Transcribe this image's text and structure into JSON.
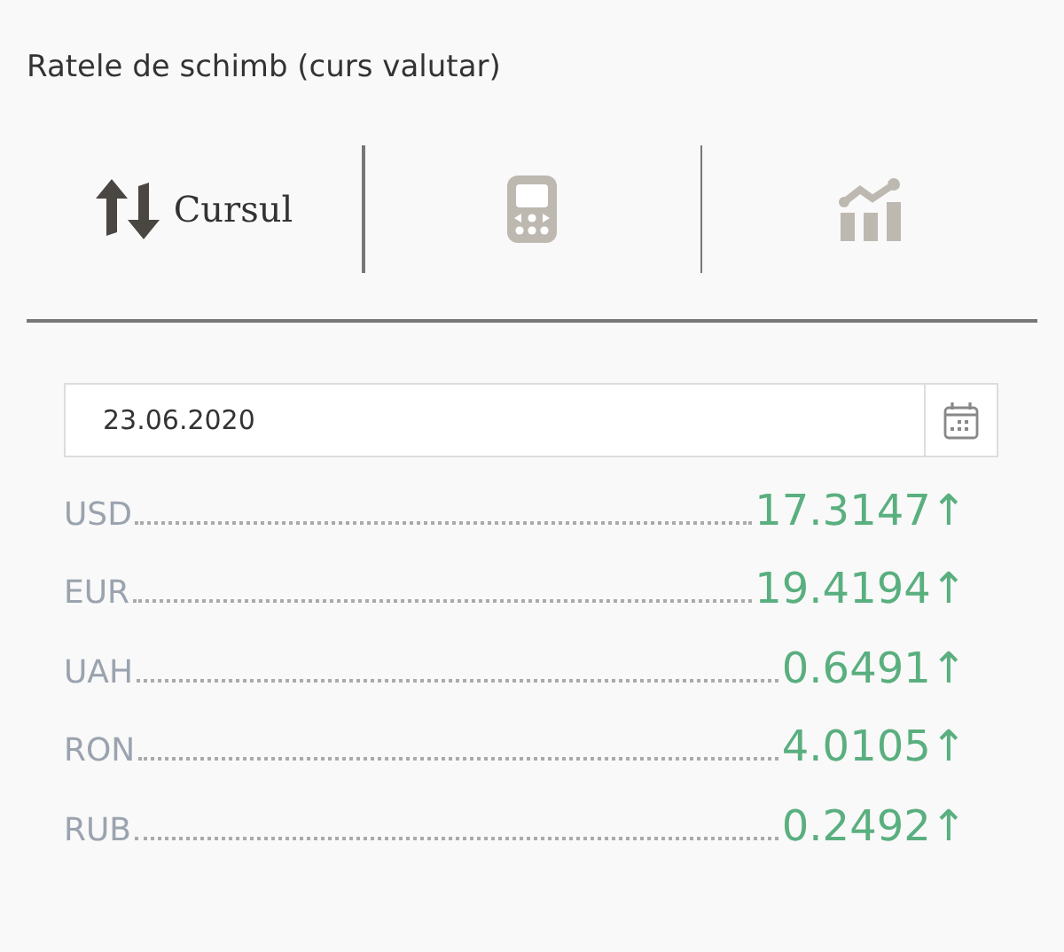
{
  "title": "Ratele de schimb (curs valutar)",
  "tabs": [
    {
      "kind": "exchange",
      "label": "Cursul",
      "selected": true
    },
    {
      "kind": "calculator",
      "selected": false
    },
    {
      "kind": "chart",
      "selected": false
    }
  ],
  "date_field": {
    "value": "23.06.2020"
  },
  "rates": [
    {
      "code": "USD",
      "value": "17.3147",
      "arrow": "↑"
    },
    {
      "code": "EUR",
      "value": "19.4194",
      "arrow": "↑"
    },
    {
      "code": "UAH",
      "value": "0.6491",
      "arrow": "↑"
    },
    {
      "code": "RON",
      "value": "4.0105",
      "arrow": "↑"
    },
    {
      "code": "RUB",
      "value": "0.2492",
      "arrow": "↑"
    }
  ]
}
